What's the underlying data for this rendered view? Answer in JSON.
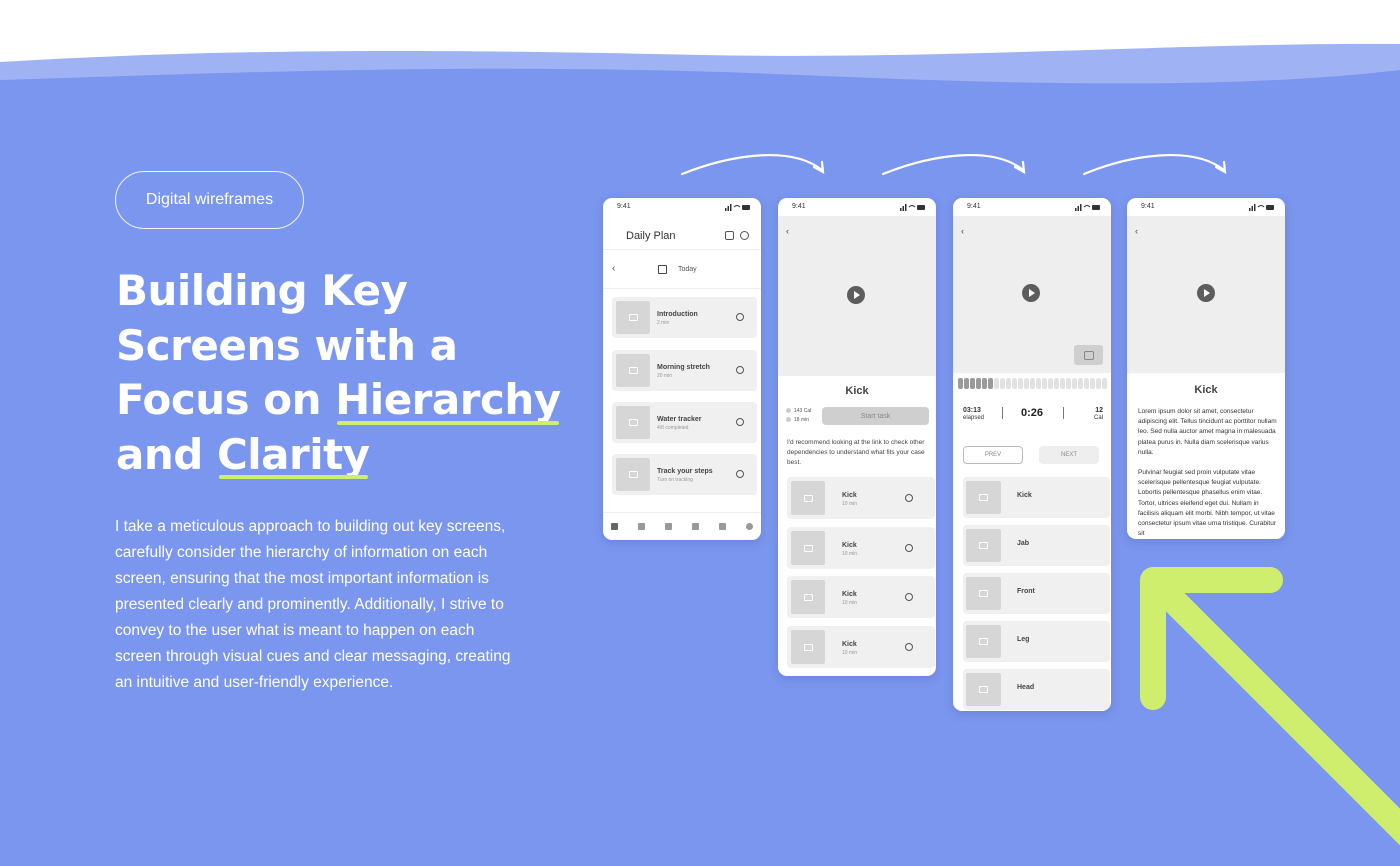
{
  "hero": {
    "tag_label": "Digital wireframes",
    "headline_line1": "Building Key",
    "headline_line2": "Screens with a",
    "headline_line3_prefix": "Focus on ",
    "headline_highlight1": "Hierarchy",
    "headline_line4_prefix": "and ",
    "headline_highlight2": "Clarity",
    "paragraph": "I take a meticulous approach to building out key screens, carefully consider the hierarchy of information on each screen, ensuring that the most important information is presented clearly and prominently. Additionally, I strive to convey to the user what is meant to happen on each screen through visual cues and clear messaging, creating an intuitive and user-friendly experience."
  },
  "colors": {
    "background": "#7b96ee",
    "wave_light": "#9fb2f3",
    "accent": "#d0ee6e"
  },
  "status_time": "9:41",
  "screen1": {
    "title": "Daily Plan",
    "back": "‹",
    "date_label": "Today",
    "items": [
      {
        "title": "Introduction",
        "sub": "2 min",
        "status_icon": "check-circle-icon"
      },
      {
        "title": "Morning stretch",
        "sub": "20 min",
        "status_icon": "empty-circle-icon"
      },
      {
        "title": "Water tracker",
        "sub": "4/8 completed",
        "status_icon": "empty-circle-icon"
      },
      {
        "title": "Track your steps",
        "sub": "Turn on tracking",
        "status_icon": "empty-circle-icon"
      }
    ],
    "tabs": [
      "plan-icon",
      "trophy-icon",
      "video-icon",
      "bolt-icon",
      "star-icon",
      "profile-icon"
    ]
  },
  "screen2": {
    "back": "‹",
    "title": "Kick",
    "meta_cal": "143 Cal",
    "meta_min": "18 min",
    "start_button": "Start task",
    "description": "I'd recommend looking at the link to check other dependencies to understand what fits your case best.",
    "items": [
      {
        "title": "Kick",
        "sub": "10 min"
      },
      {
        "title": "Kick",
        "sub": "10 min"
      },
      {
        "title": "Kick",
        "sub": "10 min"
      },
      {
        "title": "Kick",
        "sub": "10 min"
      }
    ]
  },
  "screen3": {
    "back": "‹",
    "progress_filled": 6,
    "progress_total": 25,
    "elapsed_value": "03:13",
    "elapsed_label": "elapsed",
    "timer": "0:26",
    "cal_value": "12",
    "cal_label": "Cal",
    "prev_label": "PREV",
    "next_label": "NEXT",
    "items": [
      "Kick",
      "Jab",
      "Front",
      "Leg",
      "Head"
    ]
  },
  "screen4": {
    "back": "‹",
    "title": "Kick",
    "body1": "Lorem ipsum dolor sit amet, consectetur adipiscing elit. Tellus tincidunt ac porttitor nullam leo. Sed nulla auctor amet magna in malesuada platea purus in. Nulla diam scelerisque varius nulla.",
    "body2": "Pulvinar feugiat sed proin vulputate vitae scelerisque pellentesque feugiat vulputate. Lobortis pellentesque phasellus enim vitae. Tortor, ultrices eleifend eget dui. Nullam in facilisis aliquam elit morbi. Nibh tempor, ut vitae consectetur ipsum vitae urna tristique. Curabitur sit"
  }
}
